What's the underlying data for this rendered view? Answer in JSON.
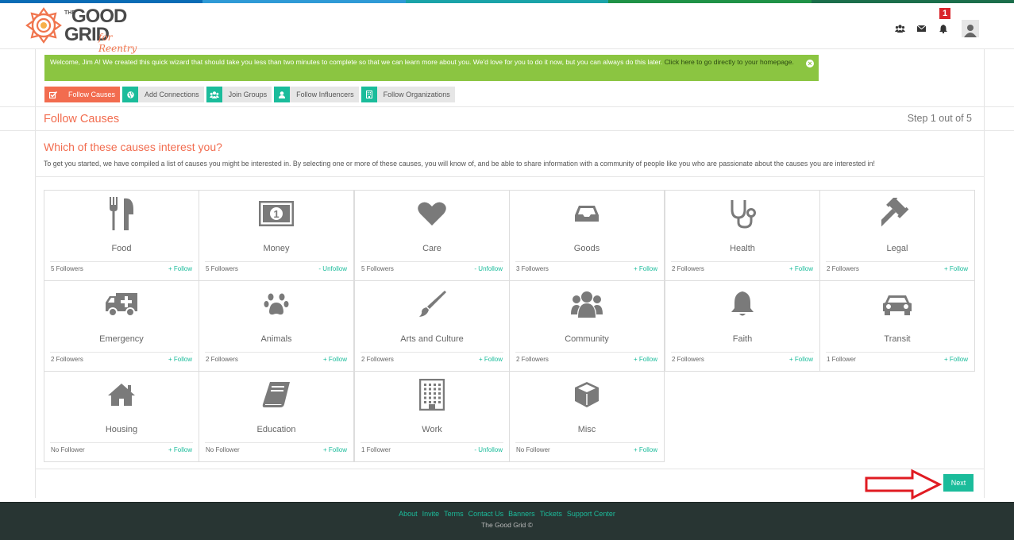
{
  "brand": {
    "name_line1": "GOOD",
    "name_line2": "GRID",
    "prefix": "THE",
    "tagline": "for Reentry",
    "stripe_colors": [
      "#0a6cb5",
      "#2f9ad6",
      "#1aa3a8",
      "#1f9247",
      "#1b6e4b"
    ],
    "accent": "#f26c4f",
    "teal": "#1bbc9b"
  },
  "header": {
    "icons": [
      "groups-icon",
      "envelope-icon",
      "bell-icon"
    ],
    "notification_count": "1"
  },
  "welcome": {
    "text": "Welcome, Jim A! We created this quick wizard that should take you less than two minutes to complete so that we can learn more about you. We'd love for you to do it now, but you can always do this later. ",
    "link": "Click here to go directly to your homepage."
  },
  "tabs": [
    {
      "label": "Follow Causes",
      "icon": "checkbox-icon",
      "active": true
    },
    {
      "label": "Add Connections",
      "icon": "globe-icon",
      "active": false
    },
    {
      "label": "Join Groups",
      "icon": "groups-icon",
      "active": false
    },
    {
      "label": "Follow Influencers",
      "icon": "user-icon",
      "active": false
    },
    {
      "label": "Follow Organizations",
      "icon": "building-icon",
      "active": false
    }
  ],
  "page": {
    "title": "Follow Causes",
    "step": "Step 1 out of 5",
    "question": "Which of these causes interest you?",
    "description": "To get you started, we have compiled a list of causes you might be interested in. By selecting one or more of these causes, you will know of, and be able to share information with a community of people like you who are passionate about the causes you are interested in!"
  },
  "causes": [
    {
      "name": "Food",
      "icon": "cutlery-icon",
      "followers": "5 Followers",
      "action": "+ Follow"
    },
    {
      "name": "Money",
      "icon": "money-icon",
      "followers": "5 Followers",
      "action": "- Unfollow"
    },
    {
      "name": "Care",
      "icon": "heart-icon",
      "followers": "5 Followers",
      "action": "- Unfollow"
    },
    {
      "name": "Goods",
      "icon": "inbox-icon",
      "followers": "3 Followers",
      "action": "+ Follow"
    },
    {
      "name": "Health",
      "icon": "stethoscope-icon",
      "followers": "2 Followers",
      "action": "+ Follow"
    },
    {
      "name": "Legal",
      "icon": "gavel-icon",
      "followers": "2 Followers",
      "action": "+ Follow"
    },
    {
      "name": "Emergency",
      "icon": "ambulance-icon",
      "followers": "2 Followers",
      "action": "+ Follow"
    },
    {
      "name": "Animals",
      "icon": "paw-icon",
      "followers": "2 Followers",
      "action": "+ Follow"
    },
    {
      "name": "Arts and Culture",
      "icon": "paintbrush-icon",
      "followers": "2 Followers",
      "action": "+ Follow"
    },
    {
      "name": "Community",
      "icon": "users-icon",
      "followers": "2 Followers",
      "action": "+ Follow"
    },
    {
      "name": "Faith",
      "icon": "bell-icon",
      "followers": "2 Followers",
      "action": "+ Follow"
    },
    {
      "name": "Transit",
      "icon": "car-icon",
      "followers": "1 Follower",
      "action": "+ Follow"
    },
    {
      "name": "Housing",
      "icon": "home-icon",
      "followers": "No Follower",
      "action": "+ Follow"
    },
    {
      "name": "Education",
      "icon": "book-icon",
      "followers": "No Follower",
      "action": "+ Follow"
    },
    {
      "name": "Work",
      "icon": "building-icon",
      "followers": "1 Follower",
      "action": "- Unfollow"
    },
    {
      "name": "Misc",
      "icon": "cube-icon",
      "followers": "No Follower",
      "action": "+ Follow"
    }
  ],
  "next_label": "Next",
  "footer": {
    "links": [
      "About",
      "Invite",
      "Terms",
      "Contact Us",
      "Banners",
      "Tickets",
      "Support Center"
    ],
    "copyright": "The Good Grid ©"
  }
}
